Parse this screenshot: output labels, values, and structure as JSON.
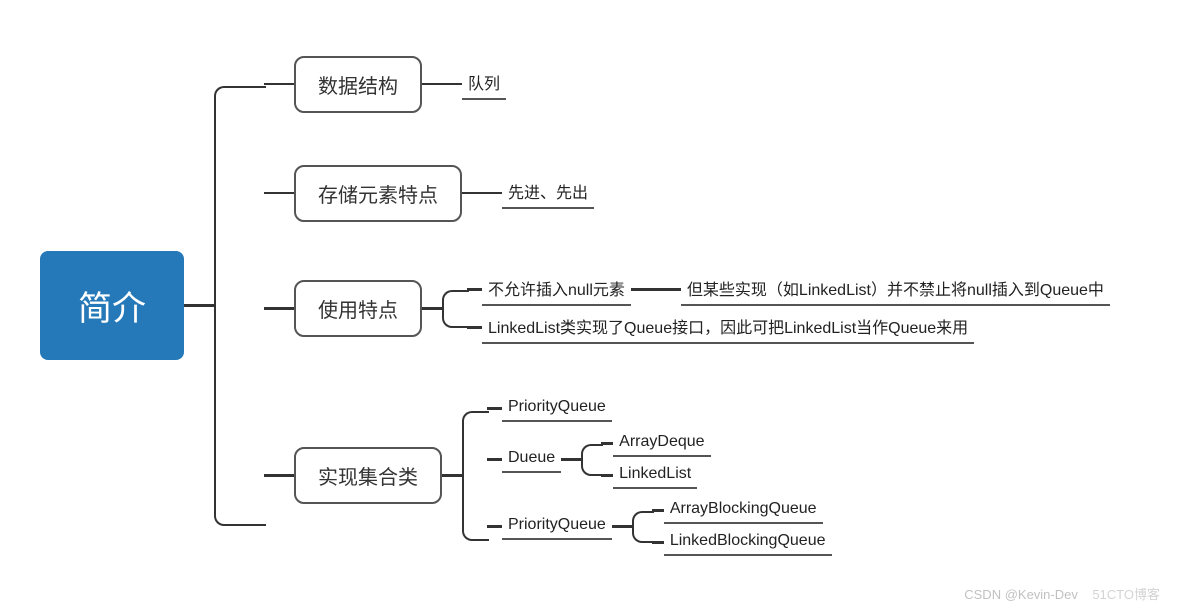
{
  "root": {
    "label": "简介"
  },
  "branches": {
    "b0": {
      "label": "数据结构",
      "leaves": {
        "l0": "队列"
      }
    },
    "b1": {
      "label": "存储元素特点",
      "leaves": {
        "l0": "先进、先出"
      }
    },
    "b2": {
      "label": "使用特点",
      "leaves": {
        "l0a": "不允许插入null元素",
        "l0b": "但某些实现（如LinkedList）并不禁止将null插入到Queue中",
        "l1": "LinkedList类实现了Queue接口，因此可把LinkedList当作Queue来用"
      }
    },
    "b3": {
      "label": "实现集合类",
      "children": {
        "c0": {
          "label": "PriorityQueue"
        },
        "c1": {
          "label": "Dueue",
          "leaves": {
            "l0": "ArrayDeque",
            "l1": "LinkedList"
          }
        },
        "c2": {
          "label": "PriorityQueue",
          "leaves": {
            "l0": "ArrayBlockingQueue",
            "l1": "LinkedBlockingQueue"
          }
        }
      }
    }
  },
  "watermark": "CSDN @Kevin-Dev",
  "watermark2": "51CTO博客"
}
